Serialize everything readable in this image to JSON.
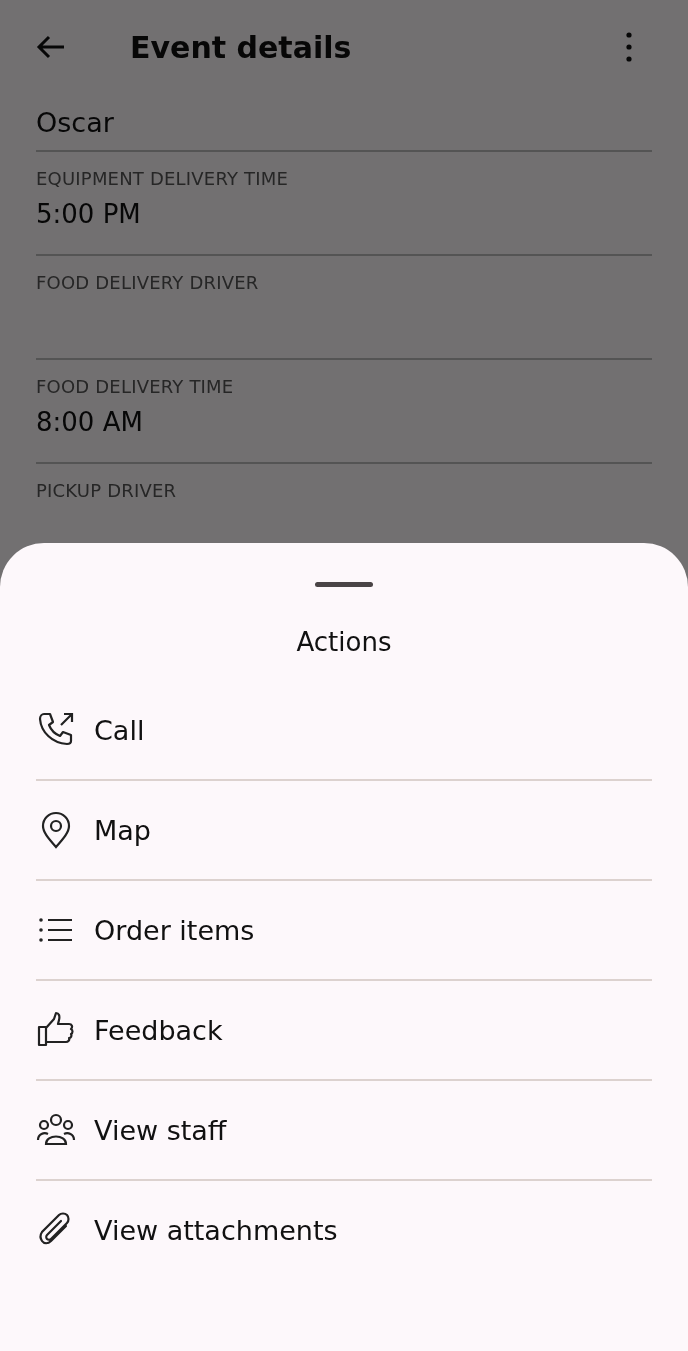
{
  "app_bar": {
    "title": "Event details"
  },
  "first_value": "Oscar",
  "fields": [
    {
      "label": "EQUIPMENT DELIVERY TIME",
      "value": "5:00 PM"
    },
    {
      "label": "FOOD DELIVERY DRIVER"
    },
    {
      "label": "FOOD DELIVERY TIME",
      "value": "8:00 AM"
    },
    {
      "label": "PICKUP DRIVER"
    }
  ],
  "sheet": {
    "title": "Actions",
    "items": [
      {
        "label": "Call",
        "kind": "call"
      },
      {
        "label": "Map",
        "kind": "map"
      },
      {
        "label": "Order items",
        "kind": "list"
      },
      {
        "label": "Feedback",
        "kind": "thumb"
      },
      {
        "label": "View staff",
        "kind": "staff"
      },
      {
        "label": "View attachments",
        "kind": "attach"
      }
    ]
  }
}
